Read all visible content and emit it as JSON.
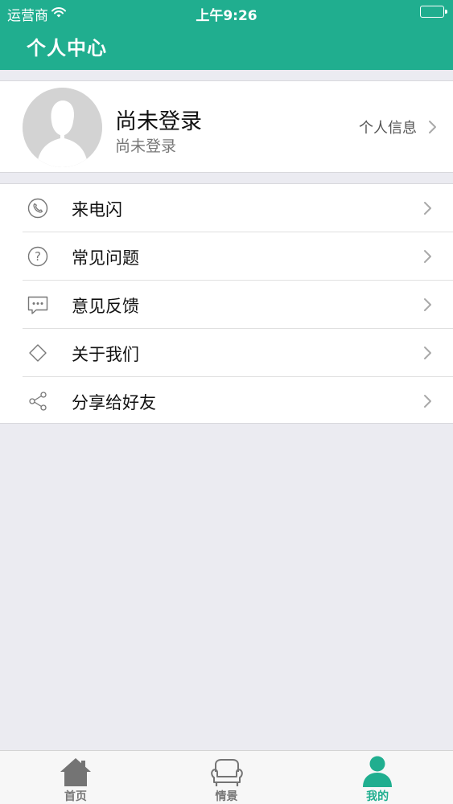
{
  "status_bar": {
    "carrier": "运营商",
    "time": "上午9:26"
  },
  "header": {
    "title": "个人中心"
  },
  "profile": {
    "name": "尚未登录",
    "subtitle": "尚未登录",
    "info_link_label": "个人信息"
  },
  "menu": {
    "items": [
      {
        "label": "来电闪",
        "icon": "phone-icon"
      },
      {
        "label": "常见问题",
        "icon": "question-icon"
      },
      {
        "label": "意见反馈",
        "icon": "chat-bubble-icon"
      },
      {
        "label": "关于我们",
        "icon": "diamond-icon"
      },
      {
        "label": "分享给好友",
        "icon": "share-icon"
      }
    ]
  },
  "tabs": [
    {
      "label": "首页",
      "icon": "home-icon",
      "active": false
    },
    {
      "label": "情景",
      "icon": "sofa-icon",
      "active": false
    },
    {
      "label": "我的",
      "icon": "person-icon",
      "active": true
    }
  ],
  "colors": {
    "accent": "#20ae8f",
    "background": "#ebebf1",
    "tab_inactive": "#777777"
  }
}
